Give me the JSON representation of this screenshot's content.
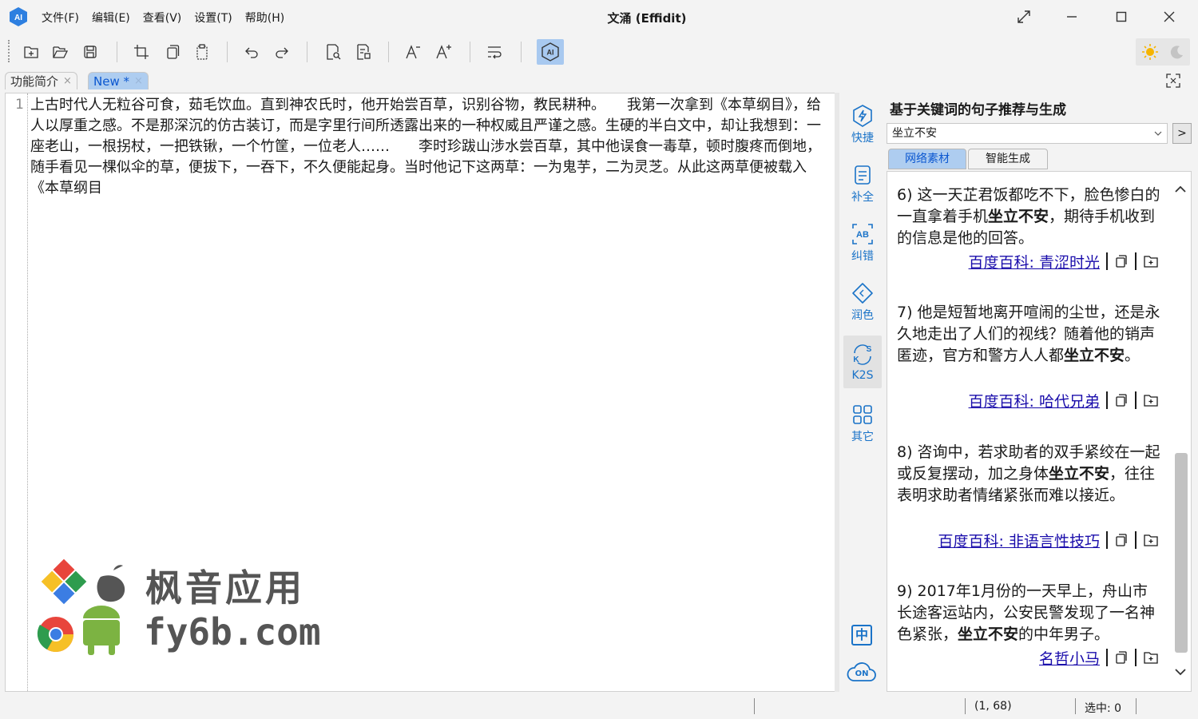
{
  "window": {
    "title": "文涌 (Effidit)",
    "menu": [
      "文件(F)",
      "编辑(E)",
      "查看(V)",
      "设置(T)",
      "帮助(H)"
    ]
  },
  "tabs": [
    {
      "label": "功能简介",
      "close": "×",
      "active": false
    },
    {
      "label": "New *",
      "close": "×",
      "active": true
    }
  ],
  "editor": {
    "line_number": "1",
    "text": "上古时代人无粒谷可食，茹毛饮血。直到神农氏时，他开始尝百草，识别谷物，教民耕种。　　我第一次拿到《本草纲目》，给人以厚重之感。不是那深沉的仿古装订，而是字里行间所透露出来的一种权威且严谨之感。生硬的半白文中，却让我想到：一座老山，一根拐杖，一把铁锹，一个竹筐，一位老人……　　李时珍跋山涉水尝百草，其中他误食一毒草，顿时腹疼而倒地，随手看见一棵似伞的草，便拔下，一吞下，不久便能起身。当时他记下这两草：一为鬼芋，二为灵芝。从此这两草便被载入《本草纲目"
  },
  "watermark": {
    "line1": "枫音应用",
    "line2": "fy6b.com"
  },
  "rail": [
    {
      "label": "快捷",
      "icon": "lightning-icon"
    },
    {
      "label": "补全",
      "icon": "document-icon"
    },
    {
      "label": "纠错",
      "icon": "spellcheck-icon"
    },
    {
      "label": "润色",
      "icon": "polish-icon"
    },
    {
      "label": "K2S",
      "icon": "k2s-icon"
    },
    {
      "label": "其它",
      "icon": "grid-icon"
    }
  ],
  "rail_bottom": {
    "lang": "中",
    "cloud": "ON"
  },
  "panel": {
    "title": "基于关键词的句子推荐与生成",
    "keyword": "坐立不安",
    "go_label": ">",
    "tabs": [
      "网络素材",
      "智能生成"
    ],
    "results": [
      {
        "pre": "6) 这一天芷君饭都吃不下，脸色惨白的一直拿着手机",
        "kw": "坐立不安",
        "post": "，期待手机收到的信息是他的回答。",
        "source": "百度百科: 青涩时光"
      },
      {
        "pre": "7) 他是短暂地离开喧闹的尘世，还是永久地走出了人们的视线？随着他的销声匿迹，官方和警方人人都",
        "kw": "坐立不安",
        "post": "。",
        "source": "百度百科: 哈代兄弟"
      },
      {
        "pre": "8) 咨询中，若求助者的双手紧绞在一起或反复摆动，加之身体",
        "kw": "坐立不安",
        "post": "，往往表明求助者情绪紧张而难以接近。",
        "source": "百度百科: 非语言性技巧"
      },
      {
        "pre": "9) 2017年1月份的一天早上，舟山市长途客运站内，公安民警发现了一名神色紧张，",
        "kw": "坐立不安",
        "post": "的中年男子。",
        "source": "名哲小马"
      }
    ]
  },
  "statusbar": {
    "position": "(1, 68)",
    "selection": "选中: 0"
  },
  "colors": {
    "accent": "#1a73c8",
    "tab_active": "#aecdf0",
    "link": "#1a0dab"
  }
}
